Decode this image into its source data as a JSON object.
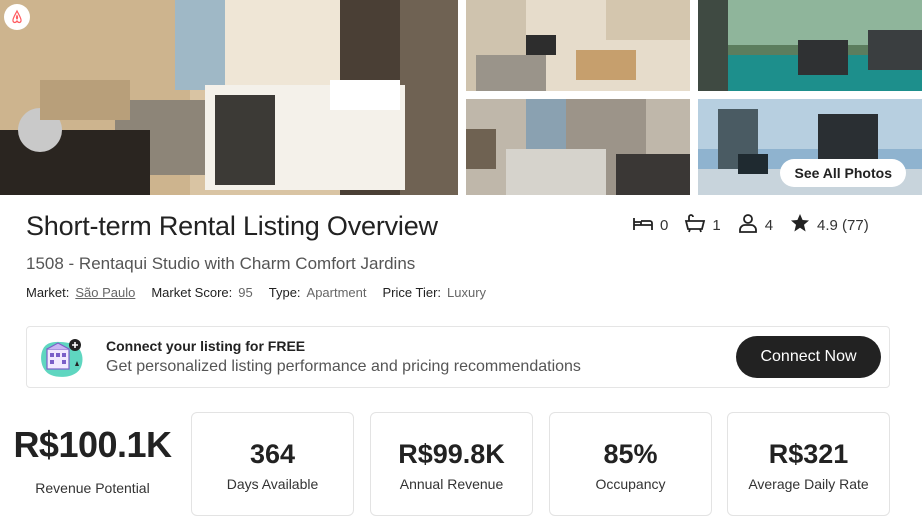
{
  "listing": {
    "title": "Short-term Rental Listing Overview",
    "name": "1508 - Rentaqui Studio with Charm Comfort Jardins"
  },
  "meta": {
    "market_label": "Market:",
    "market_value": "São Paulo",
    "score_label": "Market Score:",
    "score_value": "95",
    "type_label": "Type:",
    "type_value": "Apartment",
    "tier_label": "Price Tier:",
    "tier_value": "Luxury"
  },
  "stats": {
    "bedrooms": "0",
    "bathrooms": "1",
    "guests": "4",
    "rating": "4.9 (77)"
  },
  "photos": {
    "see_all_label": "See All Photos"
  },
  "banner": {
    "title": "Connect your listing for FREE",
    "subtitle": "Get personalized listing performance and pricing recommendations",
    "button_label": "Connect Now"
  },
  "metrics": {
    "revenue_potential_value": "R$100.1K",
    "revenue_potential_label": "Revenue Potential",
    "cards": [
      {
        "value": "364",
        "label": "Days Available"
      },
      {
        "value": "R$99.8K",
        "label": "Annual Revenue"
      },
      {
        "value": "85%",
        "label": "Occupancy"
      },
      {
        "value": "R$321",
        "label": "Average Daily Rate"
      }
    ]
  },
  "icons": {
    "brand": "airbnb-logo-icon",
    "bed": "bed-icon",
    "bath": "bathtub-icon",
    "guests": "person-icon",
    "rating": "star-icon",
    "banner": "listing-connect-illustration-icon"
  },
  "colors": {
    "brand": "#ff5a5f",
    "button_dark": "#222222",
    "banner_accent": "#5fd6c0"
  }
}
